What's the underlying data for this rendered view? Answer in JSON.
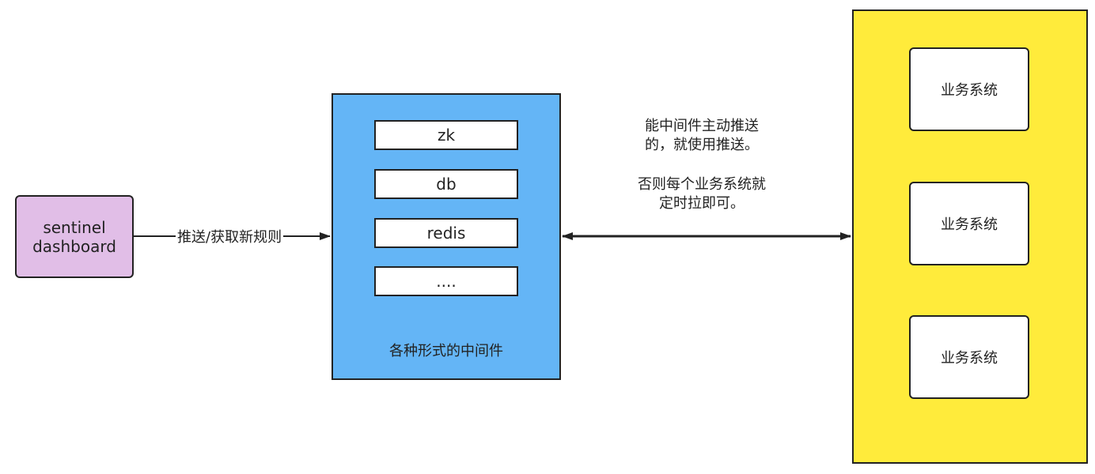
{
  "colors": {
    "sentinel_fill": "#e1bee7",
    "middleware_fill": "#64b5f6",
    "business_fill": "#ffeb3b",
    "stroke": "#222222",
    "box_fill": "#ffffff"
  },
  "sentinel": {
    "line1": "sentinel",
    "line2": "dashboard"
  },
  "edge_left_label": "推送/获取新规则",
  "middleware": {
    "items": [
      "zk",
      "db",
      "redis",
      "...."
    ],
    "label": "各种形式的中间件"
  },
  "notes": {
    "push_line1": "能中间件主动推送",
    "push_line2": "的，就使用推送。",
    "pull_line1": "否则每个业务系统就",
    "pull_line2": "定时拉即可。"
  },
  "business": {
    "systems": [
      "业务系统",
      "业务系统",
      "业务系统"
    ]
  }
}
